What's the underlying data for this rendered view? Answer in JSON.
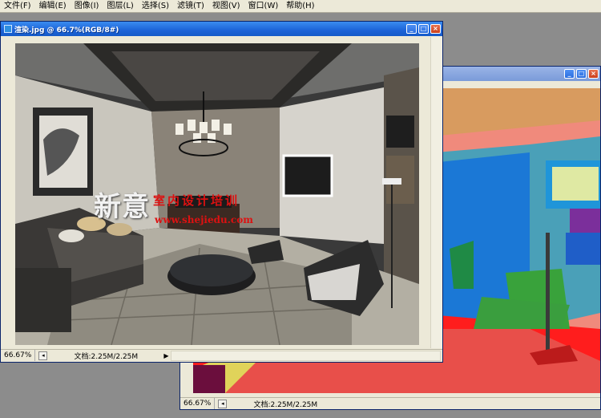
{
  "menu": [
    "文件(F)",
    "编辑(E)",
    "图像(I)",
    "图层(L)",
    "选择(S)",
    "滤镜(T)",
    "视图(V)",
    "窗口(W)",
    "帮助(H)"
  ],
  "front_window": {
    "title": "渲染.jpg @ 66.7%(RGB/8#)",
    "zoom": "66.67%",
    "doc_info": "文档:2.25M/2.25M",
    "watermark": {
      "brand": "新意",
      "tagline": "室内设计培训",
      "url": "www.shejiedu.com"
    }
  },
  "back_window": {
    "zoom": "66.67%",
    "doc_info": "文档:2.25M/2.25M"
  },
  "icons": {
    "minimize": "minimize-icon",
    "maximize": "maximize-icon",
    "close": "close-icon",
    "status_menu": "status-menu-icon",
    "scroll_right": "scroll-right-arrow-icon"
  }
}
